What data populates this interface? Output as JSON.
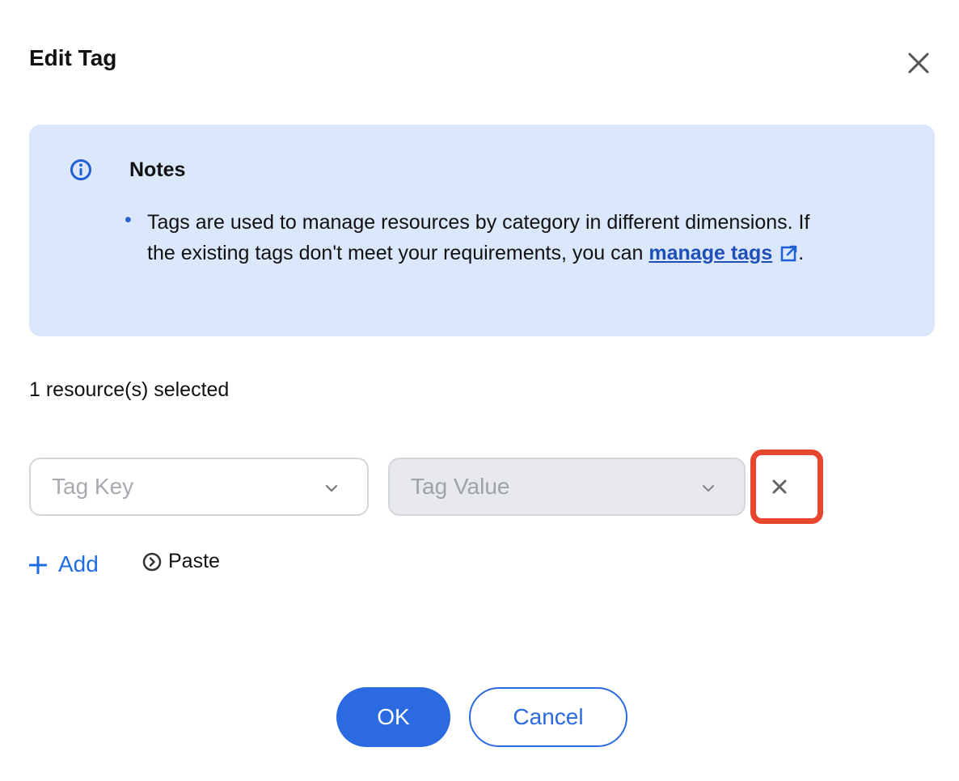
{
  "dialog": {
    "title": "Edit Tag",
    "close_icon": "close-icon"
  },
  "notice": {
    "icon": "info-icon",
    "title": "Notes",
    "bullet": "•",
    "body_text": "Tags are used to manage resources by category in different dimensions. If the existing tags don't meet your requirements, you can ",
    "link_text": "manage tags",
    "link_icon": "external-link-icon",
    "body_end": "."
  },
  "selection": {
    "count_text": "1 resource(s) selected"
  },
  "tag_row": {
    "key_placeholder": "Tag Key",
    "value_placeholder": "Tag Value",
    "remove_icon": "close-icon"
  },
  "actions": {
    "add_label": "Add",
    "paste_label": "Paste"
  },
  "footer": {
    "ok_label": "OK",
    "cancel_label": "Cancel"
  },
  "colors": {
    "primary": "#2b6ae0",
    "notice_bg": "#dbe7fb",
    "highlight": "#e8472f",
    "disabled_bg": "#e7e9ed"
  }
}
